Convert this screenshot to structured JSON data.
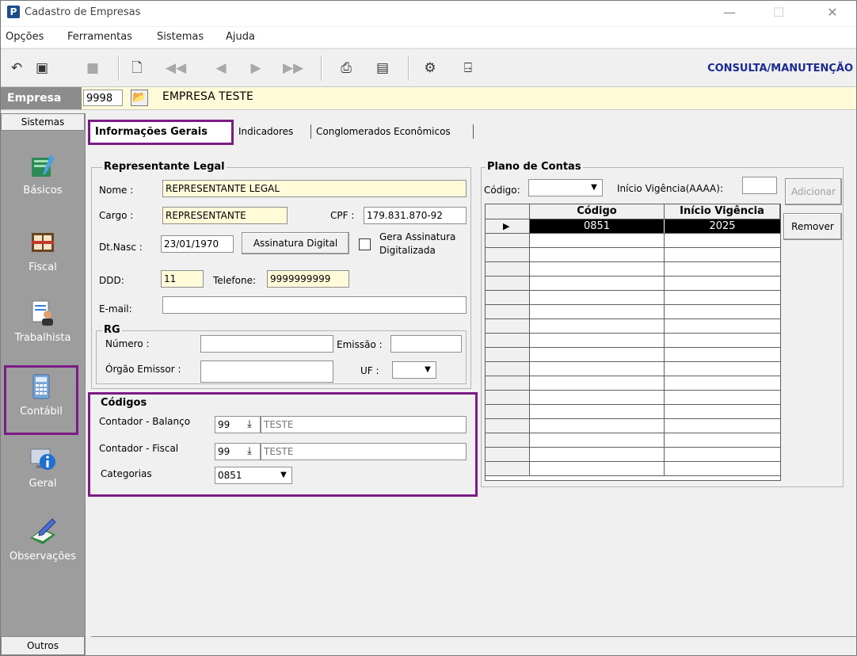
{
  "window": {
    "title": "Cadastro de Empresas",
    "minimize": "—",
    "maximize": "☐",
    "close": "✕"
  },
  "menu": [
    "Opções",
    "Ferramentas",
    "Sistemas",
    "Ajuda"
  ],
  "toolbar": {
    "mode_label": "CONSULTA/MANUTENÇÃO"
  },
  "empresa": {
    "label": "Empresa",
    "code": "9998",
    "name": "EMPRESA TESTE"
  },
  "sidebar": {
    "header": "Sistemas",
    "footer": "Outros",
    "items": [
      {
        "label": "Básicos",
        "icon": "folder-pencil-icon"
      },
      {
        "label": "Fiscal",
        "icon": "fiscal-book-icon"
      },
      {
        "label": "Trabalhista",
        "icon": "worker-document-icon"
      },
      {
        "label": "Contábil",
        "icon": "calculator-icon"
      },
      {
        "label": "Geral",
        "icon": "info-computer-icon"
      },
      {
        "label": "Observações",
        "icon": "pencil-notepad-icon"
      }
    ]
  },
  "tabs": [
    "Informações Gerais",
    "Indicadores",
    "Conglomerados Econômicos"
  ],
  "representante": {
    "title": "Representante Legal",
    "nome_label": "Nome :",
    "nome": "REPRESENTANTE LEGAL",
    "cargo_label": "Cargo :",
    "cargo": "REPRESENTANTE",
    "cpf_label": "CPF :",
    "cpf": "179.831.870-92",
    "dtnasc_label": "Dt.Nasc :",
    "dtnasc": "23/01/1970",
    "assinatura_button": "Assinatura Digital",
    "gera_assinatura_label_1": "Gera Assinatura",
    "gera_assinatura_label_2": "Digitalizada",
    "ddd_label": "DDD:",
    "ddd": "11",
    "telefone_label": "Telefone:",
    "telefone": "9999999999",
    "email_label": "E-mail:",
    "email": ""
  },
  "rg": {
    "title": "RG",
    "numero_label": "Número :",
    "numero": "",
    "emissao_label": "Emissão :",
    "emissao": "",
    "orgao_label": "Órgão Emissor :",
    "orgao": "",
    "uf_label": "UF :",
    "uf": ""
  },
  "codigos": {
    "title": "Códigos",
    "balanco_label": "Contador - Balanço",
    "balanco_code": "99",
    "balanco_name": "TESTE",
    "fiscal_label": "Contador - Fiscal",
    "fiscal_code": "99",
    "fiscal_name": "TESTE",
    "categorias_label": "Categorias",
    "categorias": "0851"
  },
  "plano": {
    "title": "Plano de Contas",
    "codigo_label": "Código:",
    "codigo": "",
    "vigencia_label": "Início Vigência(AAAA):",
    "vigencia": "",
    "add_button": "Adicionar",
    "remove_button": "Remover",
    "columns": [
      "Código",
      "Início Vigência"
    ],
    "rows": [
      {
        "codigo": "0851",
        "vigencia": "2025"
      }
    ]
  }
}
